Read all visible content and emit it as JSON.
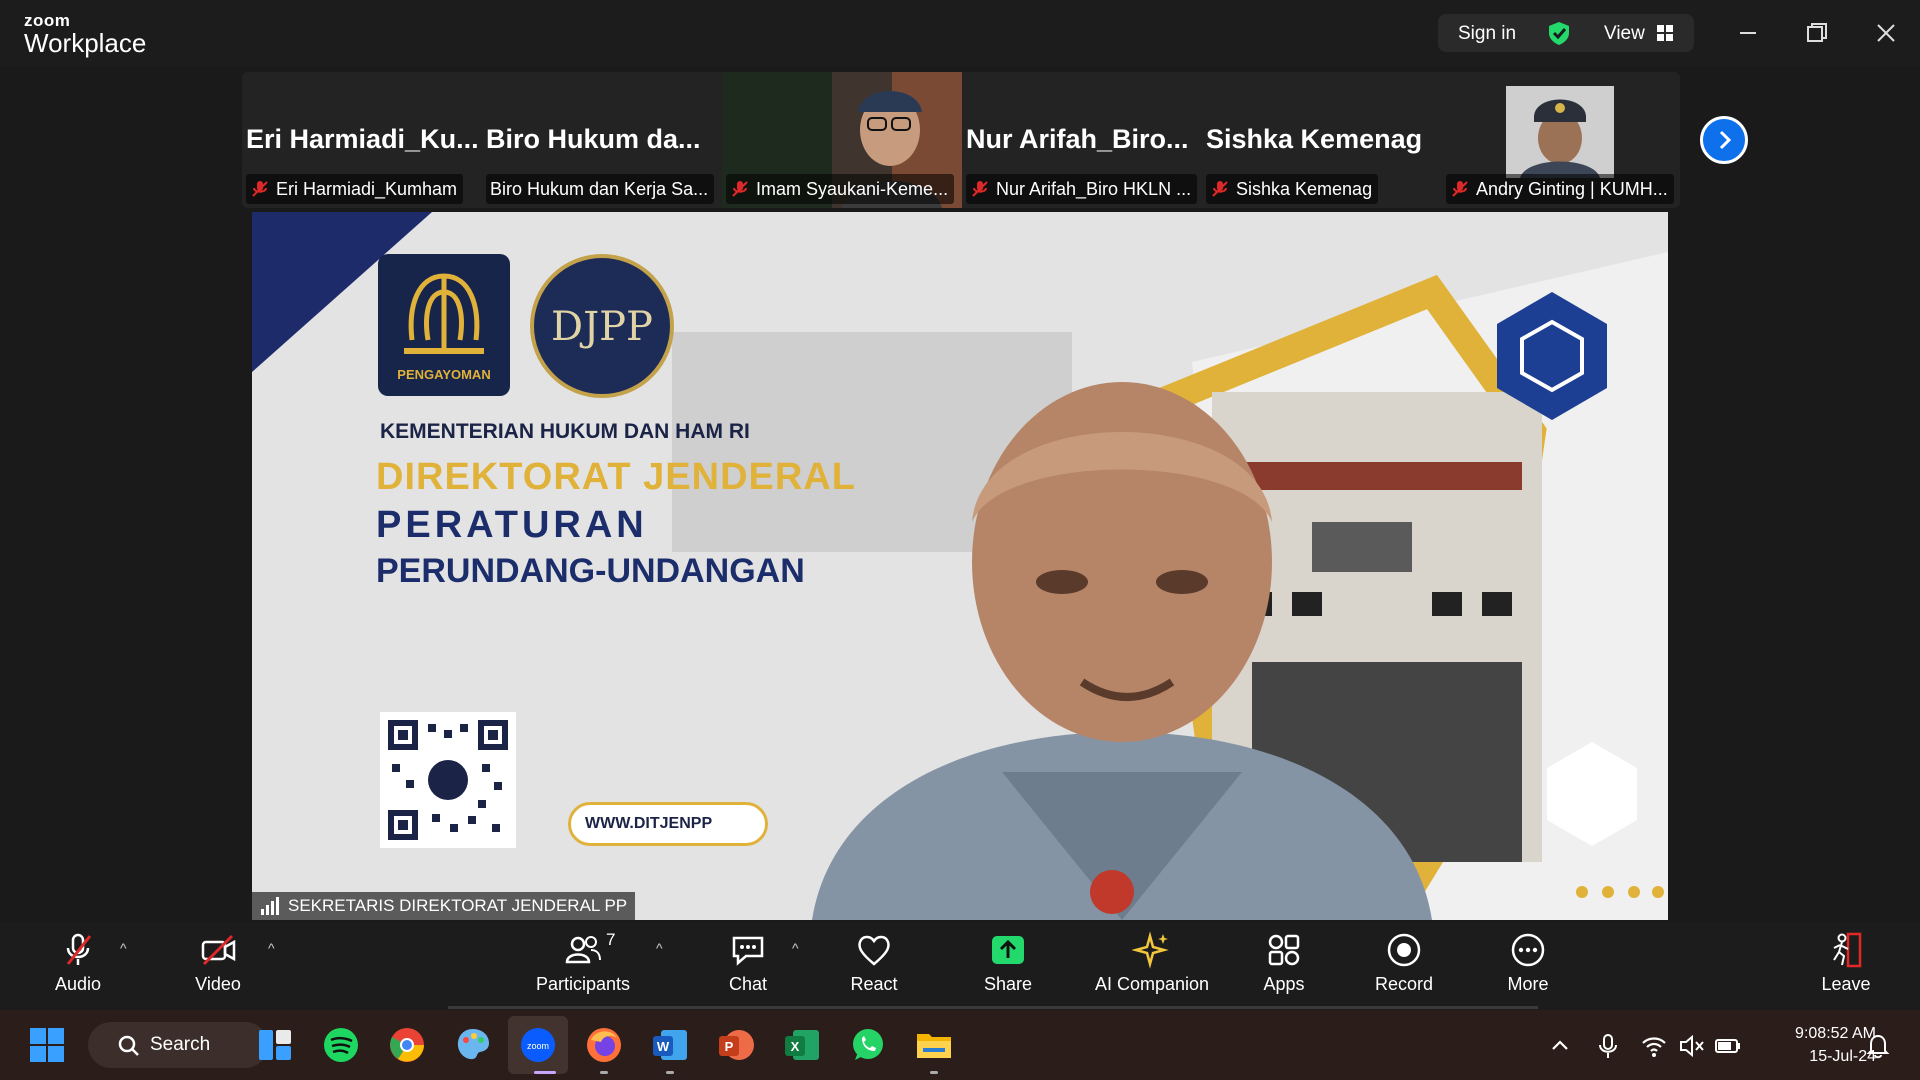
{
  "app": {
    "logo_small": "zoom",
    "logo_big": "Workplace",
    "sign_in": "Sign in",
    "view": "View"
  },
  "gallery": {
    "tiles": [
      {
        "title": "Eri  Harmiadi_Ku...",
        "name": "Eri Harmiadi_Kumham",
        "muted": true
      },
      {
        "title": "Biro  Hukum  da...",
        "name": "Biro Hukum dan Kerja Sa...",
        "muted": false
      },
      {
        "title": "",
        "name": "Imam Syaukani-Keme...",
        "muted": true
      },
      {
        "title": "Nur  Arifah_Biro...",
        "name": "Nur Arifah_Biro HKLN ...",
        "muted": true
      },
      {
        "title": "Sishka Kemenag",
        "name": "Sishka Kemenag",
        "muted": true
      },
      {
        "title": "",
        "name": "Andry Ginting | KUMH...",
        "muted": true
      }
    ]
  },
  "main_video": {
    "speaker_name": "SEKRETARIS DIREKTORAT JENDERAL PP",
    "slide": {
      "logo_label": "PENGAYOMAN",
      "emblem": "DJPP",
      "line1": "KEMENTERIAN HUKUM DAN HAM RI",
      "line2": "DIREKTORAT JENDERAL",
      "line3": "PERATURAN",
      "line4": "PERUNDANG-UNDANGAN",
      "website": "WWW.DITJENPP"
    }
  },
  "toolbar": {
    "audio": "Audio",
    "video": "Video",
    "participants": "Participants",
    "participants_count": "7",
    "chat": "Chat",
    "react": "React",
    "share": "Share",
    "ai_companion": "AI Companion",
    "apps": "Apps",
    "record": "Record",
    "more": "More",
    "leave": "Leave"
  },
  "taskbar": {
    "search": "Search",
    "time": "9:08:52 AM",
    "date": "15-Jul-24"
  }
}
